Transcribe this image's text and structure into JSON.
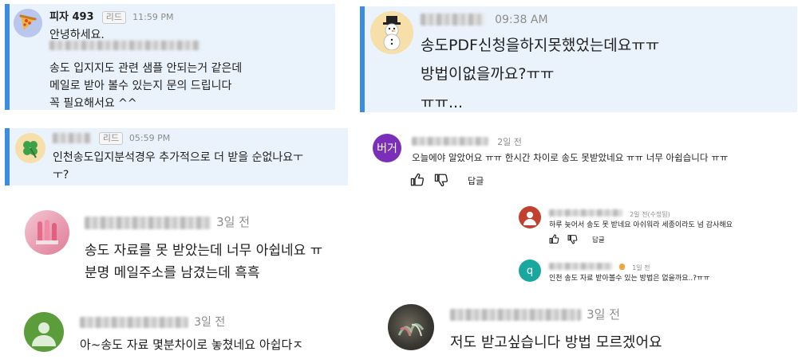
{
  "c1": {
    "author": "피자 493",
    "tag": "리드",
    "time": "11:59 PM",
    "line1": "안녕하세요.",
    "line3": "송도 입지지도 관련 샘플 안되는거 같은데",
    "line4": "메일로 받아 볼수 있는지 문의 드립니다",
    "line5": "꼭 필요해서요 ^^"
  },
  "c2": {
    "time": "09:38 AM",
    "line1": "송도PDF신청을하지못했었는데요ㅠㅠ",
    "line2": "방법이없을까요?ㅠㅠ",
    "line3": "ㅠㅠ..."
  },
  "c3": {
    "tag": "리드",
    "time": "05:59 PM",
    "line1": "인천송도입지분석경우 추가적으로 더 받을 순없나요ㅜ",
    "line2": "ㅜ?"
  },
  "c4": {
    "avatar_text": "버거",
    "time": "2일 전",
    "text": "오늘에야 알았어요 ㅠㅠ 한시간 차이로 송도 못받았네요 ㅠㅠ 너무 아쉽습니다 ㅠㅠ",
    "reply": "답글"
  },
  "c5": {
    "time": "2일 전(수정됨)",
    "text": "하루 늦어서 송도 못 받네요 아쉬워라 세종이라도 넘 감사해요",
    "reply": "답글"
  },
  "c6": {
    "avatar_text": "q",
    "time": "1일 전",
    "text": "인천 송도 자료 받아볼수 있는 방법은 없을까요..?ㅠㅠ"
  },
  "c7": {
    "time": "3일 전",
    "line1": "송도 자료를 못 받았는데 너무 아쉽네요 ㅠ",
    "line2": "분명 메일주소를 남겼는데 흑흑"
  },
  "c8": {
    "time": "3일 전",
    "text": "아~송도 자료  몇분차이로 놓쳤네요  아쉽다ㅈ"
  },
  "c9": {
    "time": "3일 전",
    "text": "저도 받고싶습니다 방법 모르겠어요"
  },
  "colors": {
    "accent": "#3a8de0",
    "card_bg": "#eaf2fb",
    "c4_avatar": "#7b2fb8",
    "c6_avatar": "#1aa7a0"
  }
}
